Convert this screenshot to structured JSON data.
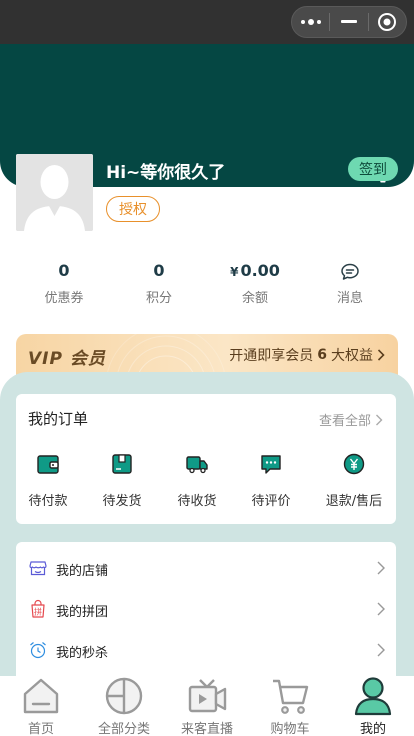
{
  "header": {
    "greeting": "Hi~等你很久了",
    "checkin_label": "签到",
    "auth_label": "授权"
  },
  "stats": [
    {
      "value": "0",
      "label": "优惠券"
    },
    {
      "value": "0",
      "label": "积分"
    },
    {
      "currency": "¥",
      "value": "0.00",
      "label": "余额"
    },
    {
      "label": "消息"
    }
  ],
  "vip": {
    "logo": "VIP 会员",
    "text_before": "开通即享会员",
    "count": "6",
    "text_after": "大权益"
  },
  "orders": {
    "title": "我的订单",
    "view_all": "查看全部",
    "items": [
      {
        "label": "待付款",
        "icon": "wallet-icon"
      },
      {
        "label": "待发货",
        "icon": "package-icon"
      },
      {
        "label": "待收货",
        "icon": "truck-icon"
      },
      {
        "label": "待评价",
        "icon": "comment-icon"
      },
      {
        "label": "退款/售后",
        "icon": "refund-icon"
      }
    ]
  },
  "menu": [
    {
      "label": "我的店铺",
      "icon": "shop-icon"
    },
    {
      "label": "我的拼团",
      "icon": "group-buy-icon"
    },
    {
      "label": "我的秒杀",
      "icon": "alarm-clock-icon"
    }
  ],
  "tabbar": [
    {
      "label": "首页",
      "icon": "home-icon"
    },
    {
      "label": "全部分类",
      "icon": "category-icon"
    },
    {
      "label": "来客直播",
      "icon": "live-icon"
    },
    {
      "label": "购物车",
      "icon": "cart-icon"
    },
    {
      "label": "我的",
      "icon": "profile-icon",
      "active": true
    }
  ],
  "colors": {
    "header_bg": "#054743",
    "accent_green": "#6ed9b1",
    "auth_orange": "#e8902b",
    "page_bg": "#cfe4e2"
  }
}
